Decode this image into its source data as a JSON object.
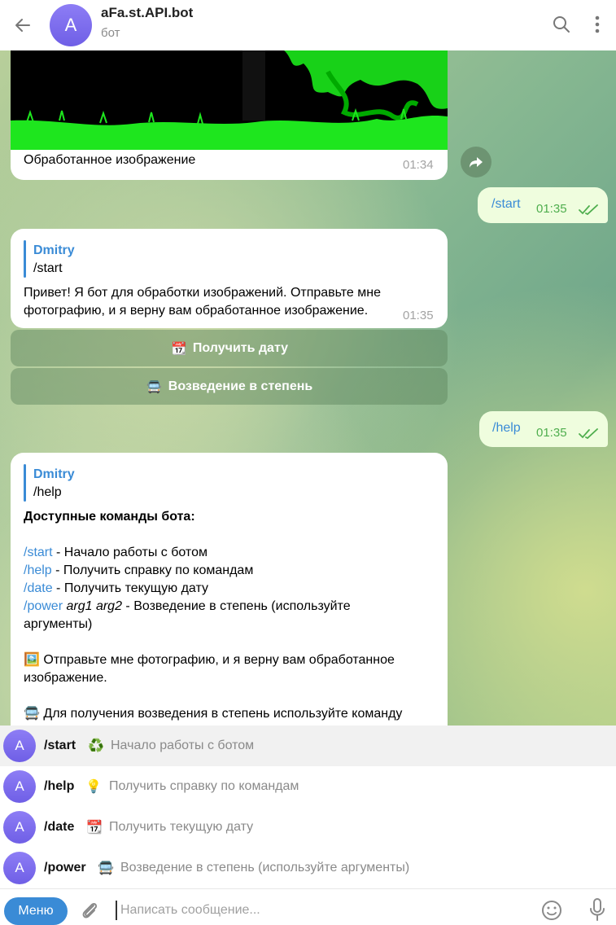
{
  "header": {
    "avatar_letter": "A",
    "title": "aFa.st.API.bot",
    "subtitle": "бот"
  },
  "messages": {
    "photo_caption": "Обработанное изображение",
    "photo_time": "01:34",
    "out_start": {
      "text": "/start",
      "time": "01:35"
    },
    "start_reply": {
      "reply_name": "Dmitry",
      "reply_text": "/start",
      "text": "Привет! Я бот для обработки изображений. Отправьте мне фотографию, и я верну вам обработанное изображение.",
      "time": "01:35"
    },
    "keyboard": [
      {
        "emoji": "📆",
        "label": "Получить дату"
      },
      {
        "emoji": "🚍",
        "label": "Возведение в степень"
      }
    ],
    "out_help": {
      "text": "/help",
      "time": "01:35"
    },
    "help_reply": {
      "reply_name": "Dmitry",
      "reply_text": "/help",
      "heading": "Доступные команды бота:",
      "lines": [
        {
          "cmd": "/start",
          "rest": " - Начало работы с ботом"
        },
        {
          "cmd": "/help",
          "rest": " - Получить справку по командам"
        },
        {
          "cmd": "/date",
          "rest": " - Получить текущую дату"
        },
        {
          "cmd": "/power",
          "args": " arg1 arg2",
          "rest": " - Возведение в степень (используйте",
          "rest2": "аргументы)"
        }
      ],
      "photo_emoji": "🖼️",
      "photo_line1": "Отправьте мне фотографию, и я верну вам обработанное",
      "photo_line2": "изображение.",
      "power_emoji": "🚍",
      "power_line": "Для получения возведения в степень используйте команду"
    }
  },
  "suggestions": [
    {
      "avatar": "A",
      "cmd": "/start",
      "emoji": "♻️",
      "desc": "Начало работы с ботом",
      "selected": true
    },
    {
      "avatar": "A",
      "cmd": "/help",
      "emoji": "💡",
      "desc": "Получить справку по командам"
    },
    {
      "avatar": "A",
      "cmd": "/date",
      "emoji": "📆",
      "desc": "Получить текущую дату"
    },
    {
      "avatar": "A",
      "cmd": "/power",
      "emoji": "🚍",
      "desc": "Возведение в степень (используйте аргументы)"
    }
  ],
  "composer": {
    "menu_label": "Меню",
    "placeholder": "Написать сообщение..."
  },
  "colors": {
    "accent": "#3a8bd6",
    "out_bubble": "#effdde",
    "out_time": "#4fae4e"
  }
}
